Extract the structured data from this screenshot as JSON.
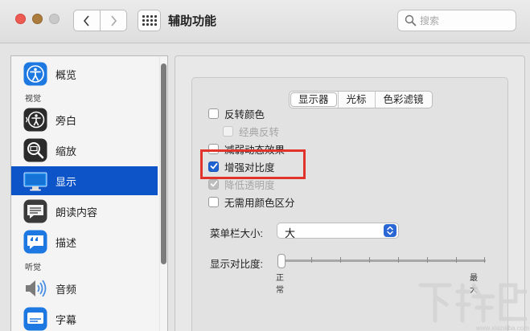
{
  "window": {
    "title": "辅助功能",
    "traffic_lights": {
      "close": "#ee5b52",
      "minimize": "#ab7c3d",
      "zoom": "#c9c9c9"
    }
  },
  "toolbar": {
    "back_icon": "chevron-left-icon",
    "forward_icon": "chevron-right-icon",
    "show_all_icon": "grid-icon",
    "search_placeholder": "搜索"
  },
  "sidebar": {
    "selected_color": "#0d54c9",
    "items": [
      {
        "label": "概览",
        "icon": "accessibility-icon"
      },
      {
        "section": "视觉"
      },
      {
        "label": "旁白",
        "icon": "voiceover-icon"
      },
      {
        "label": "缩放",
        "icon": "zoom-icon"
      },
      {
        "label": "显示",
        "icon": "display-icon",
        "selected": true
      },
      {
        "label": "朗读内容",
        "icon": "speech-bubble-icon"
      },
      {
        "label": "描述",
        "icon": "descriptions-icon"
      },
      {
        "section": "听觉"
      },
      {
        "label": "音频",
        "icon": "speaker-icon"
      },
      {
        "label": "字幕",
        "icon": "captions-icon"
      }
    ]
  },
  "tabs": [
    {
      "label": "显示器",
      "active": true
    },
    {
      "label": "光标",
      "active": false
    },
    {
      "label": "色彩滤镜",
      "active": false
    }
  ],
  "options": [
    {
      "label": "反转颜色",
      "checked": false,
      "enabled": true
    },
    {
      "label": "经典反转",
      "checked": false,
      "enabled": false
    },
    {
      "label": "减弱动态效果",
      "checked": false,
      "enabled": true
    },
    {
      "label": "增强对比度",
      "checked": true,
      "enabled": true
    },
    {
      "label": "降低透明度",
      "checked": true,
      "enabled": false
    },
    {
      "label": "无需用颜色区分",
      "checked": false,
      "enabled": true
    }
  ],
  "menubar_size": {
    "label": "菜单栏大小:",
    "value": "大"
  },
  "contrast": {
    "label": "显示对比度:",
    "min_label": "正常",
    "max_label": "最大",
    "level": 0
  },
  "highlight_color": "#e1322b",
  "watermark": {
    "text": "下载吧",
    "url": "www.xiazaiba.com"
  }
}
